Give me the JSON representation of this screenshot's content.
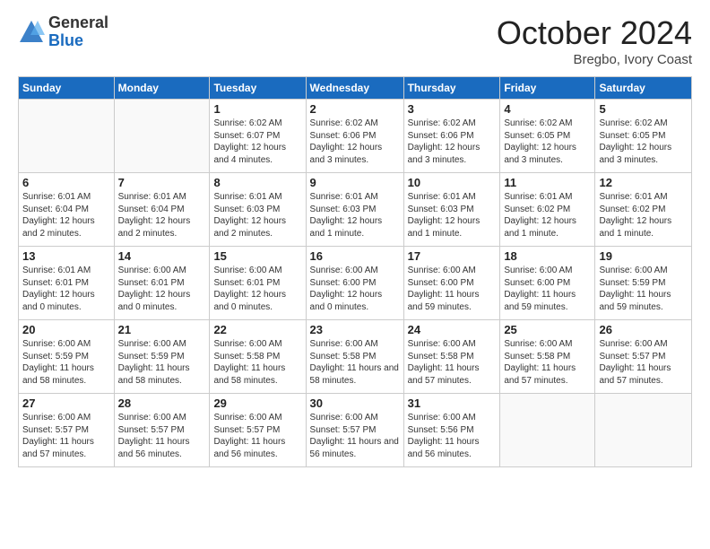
{
  "logo": {
    "general": "General",
    "blue": "Blue"
  },
  "title": "October 2024",
  "subtitle": "Bregbo, Ivory Coast",
  "days": [
    "Sunday",
    "Monday",
    "Tuesday",
    "Wednesday",
    "Thursday",
    "Friday",
    "Saturday"
  ],
  "weeks": [
    [
      {
        "day": "",
        "info": ""
      },
      {
        "day": "",
        "info": ""
      },
      {
        "day": "1",
        "info": "Sunrise: 6:02 AM\nSunset: 6:07 PM\nDaylight: 12 hours and 4 minutes."
      },
      {
        "day": "2",
        "info": "Sunrise: 6:02 AM\nSunset: 6:06 PM\nDaylight: 12 hours and 3 minutes."
      },
      {
        "day": "3",
        "info": "Sunrise: 6:02 AM\nSunset: 6:06 PM\nDaylight: 12 hours and 3 minutes."
      },
      {
        "day": "4",
        "info": "Sunrise: 6:02 AM\nSunset: 6:05 PM\nDaylight: 12 hours and 3 minutes."
      },
      {
        "day": "5",
        "info": "Sunrise: 6:02 AM\nSunset: 6:05 PM\nDaylight: 12 hours and 3 minutes."
      }
    ],
    [
      {
        "day": "6",
        "info": "Sunrise: 6:01 AM\nSunset: 6:04 PM\nDaylight: 12 hours and 2 minutes."
      },
      {
        "day": "7",
        "info": "Sunrise: 6:01 AM\nSunset: 6:04 PM\nDaylight: 12 hours and 2 minutes."
      },
      {
        "day": "8",
        "info": "Sunrise: 6:01 AM\nSunset: 6:03 PM\nDaylight: 12 hours and 2 minutes."
      },
      {
        "day": "9",
        "info": "Sunrise: 6:01 AM\nSunset: 6:03 PM\nDaylight: 12 hours and 1 minute."
      },
      {
        "day": "10",
        "info": "Sunrise: 6:01 AM\nSunset: 6:03 PM\nDaylight: 12 hours and 1 minute."
      },
      {
        "day": "11",
        "info": "Sunrise: 6:01 AM\nSunset: 6:02 PM\nDaylight: 12 hours and 1 minute."
      },
      {
        "day": "12",
        "info": "Sunrise: 6:01 AM\nSunset: 6:02 PM\nDaylight: 12 hours and 1 minute."
      }
    ],
    [
      {
        "day": "13",
        "info": "Sunrise: 6:01 AM\nSunset: 6:01 PM\nDaylight: 12 hours and 0 minutes."
      },
      {
        "day": "14",
        "info": "Sunrise: 6:00 AM\nSunset: 6:01 PM\nDaylight: 12 hours and 0 minutes."
      },
      {
        "day": "15",
        "info": "Sunrise: 6:00 AM\nSunset: 6:01 PM\nDaylight: 12 hours and 0 minutes."
      },
      {
        "day": "16",
        "info": "Sunrise: 6:00 AM\nSunset: 6:00 PM\nDaylight: 12 hours and 0 minutes."
      },
      {
        "day": "17",
        "info": "Sunrise: 6:00 AM\nSunset: 6:00 PM\nDaylight: 11 hours and 59 minutes."
      },
      {
        "day": "18",
        "info": "Sunrise: 6:00 AM\nSunset: 6:00 PM\nDaylight: 11 hours and 59 minutes."
      },
      {
        "day": "19",
        "info": "Sunrise: 6:00 AM\nSunset: 5:59 PM\nDaylight: 11 hours and 59 minutes."
      }
    ],
    [
      {
        "day": "20",
        "info": "Sunrise: 6:00 AM\nSunset: 5:59 PM\nDaylight: 11 hours and 58 minutes."
      },
      {
        "day": "21",
        "info": "Sunrise: 6:00 AM\nSunset: 5:59 PM\nDaylight: 11 hours and 58 minutes."
      },
      {
        "day": "22",
        "info": "Sunrise: 6:00 AM\nSunset: 5:58 PM\nDaylight: 11 hours and 58 minutes."
      },
      {
        "day": "23",
        "info": "Sunrise: 6:00 AM\nSunset: 5:58 PM\nDaylight: 11 hours and 58 minutes."
      },
      {
        "day": "24",
        "info": "Sunrise: 6:00 AM\nSunset: 5:58 PM\nDaylight: 11 hours and 57 minutes."
      },
      {
        "day": "25",
        "info": "Sunrise: 6:00 AM\nSunset: 5:58 PM\nDaylight: 11 hours and 57 minutes."
      },
      {
        "day": "26",
        "info": "Sunrise: 6:00 AM\nSunset: 5:57 PM\nDaylight: 11 hours and 57 minutes."
      }
    ],
    [
      {
        "day": "27",
        "info": "Sunrise: 6:00 AM\nSunset: 5:57 PM\nDaylight: 11 hours and 57 minutes."
      },
      {
        "day": "28",
        "info": "Sunrise: 6:00 AM\nSunset: 5:57 PM\nDaylight: 11 hours and 56 minutes."
      },
      {
        "day": "29",
        "info": "Sunrise: 6:00 AM\nSunset: 5:57 PM\nDaylight: 11 hours and 56 minutes."
      },
      {
        "day": "30",
        "info": "Sunrise: 6:00 AM\nSunset: 5:57 PM\nDaylight: 11 hours and 56 minutes."
      },
      {
        "day": "31",
        "info": "Sunrise: 6:00 AM\nSunset: 5:56 PM\nDaylight: 11 hours and 56 minutes."
      },
      {
        "day": "",
        "info": ""
      },
      {
        "day": "",
        "info": ""
      }
    ]
  ]
}
